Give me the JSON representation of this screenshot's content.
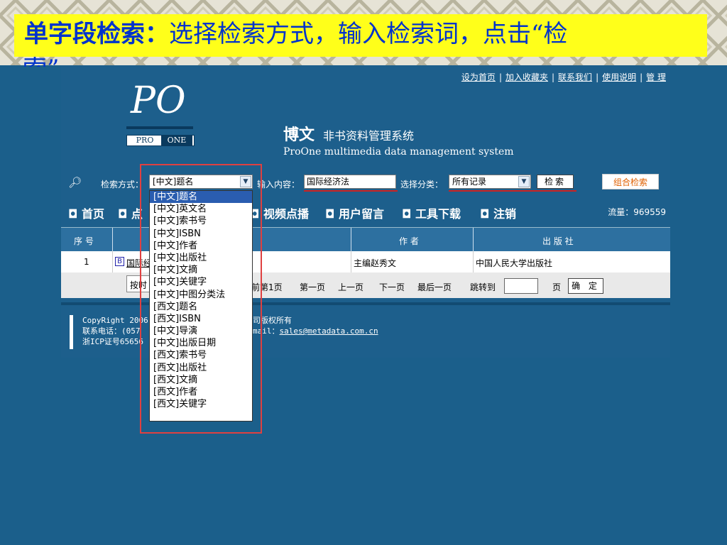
{
  "caption": {
    "bold": "单字段检索：",
    "rest": "选择检索方式，输入检索词，点击“检",
    "wrap": "索”"
  },
  "toplinks": [
    "设为首页",
    "加入收藏夹",
    "联系我们",
    "使用说明",
    "管 理"
  ],
  "logo": {
    "mark": "PO",
    "pro": "PRO",
    "one": "ONE"
  },
  "brand": {
    "cn": "博文",
    "cn_sub": "非书资料管理系统",
    "en": "ProOne  multimedia data management system"
  },
  "search": {
    "method_label": "检索方式：",
    "method_value": "[中文]题名",
    "content_label": "输入内容：",
    "content_value": "国际经济法",
    "category_label": "选择分类：",
    "category_value": "所有记录",
    "search_button": "检索",
    "advanced_button": "组合检索"
  },
  "nav": {
    "items": [
      "首页",
      "点",
      "视频点播",
      "用户留言",
      "工具下载",
      "注销"
    ],
    "traffic": "流量：969559"
  },
  "table": {
    "headers": [
      "序 号",
      "作 者",
      "出 版 社"
    ],
    "rows": [
      {
        "no": "1",
        "title": "国际经",
        "author": "主编赵秀文",
        "publisher": "中国人民大学出版社"
      }
    ]
  },
  "pager": {
    "sort": "按时",
    "current": "前第1页",
    "first": "第一页",
    "prev": "上一页",
    "next": "下一页",
    "last": "最后一页",
    "jump": "跳转到",
    "page": "页",
    "ok": "确 定"
  },
  "footer": {
    "line1": "CopyRight 2006",
    "line2": "联系电话：(057",
    "line3": "浙ICP证号65656",
    "right1": "司版权所有",
    "right2": "mail：",
    "email": "sales@metadata.com.cn"
  },
  "dropdown": {
    "options": [
      "[中文]题名",
      "[中文]英文名",
      "[中文]索书号",
      "[中文]ISBN",
      "[中文]作者",
      "[中文]出版社",
      "[中文]文摘",
      "[中文]关键字",
      "[中文]中图分类法",
      "[西文]题名",
      "[西文]ISBN",
      "[中文]导演",
      "[中文]出版日期",
      "[西文]索书号",
      "[西文]出版社",
      "[西文]文摘",
      "[西文]作者",
      "[西文]关键字"
    ],
    "selected_index": 0
  },
  "colors": {
    "caption_bg": "#ffff1a",
    "caption_text": "#0033cc",
    "app_bg": "#1d5f8c",
    "highlight_box": "#e04040"
  }
}
